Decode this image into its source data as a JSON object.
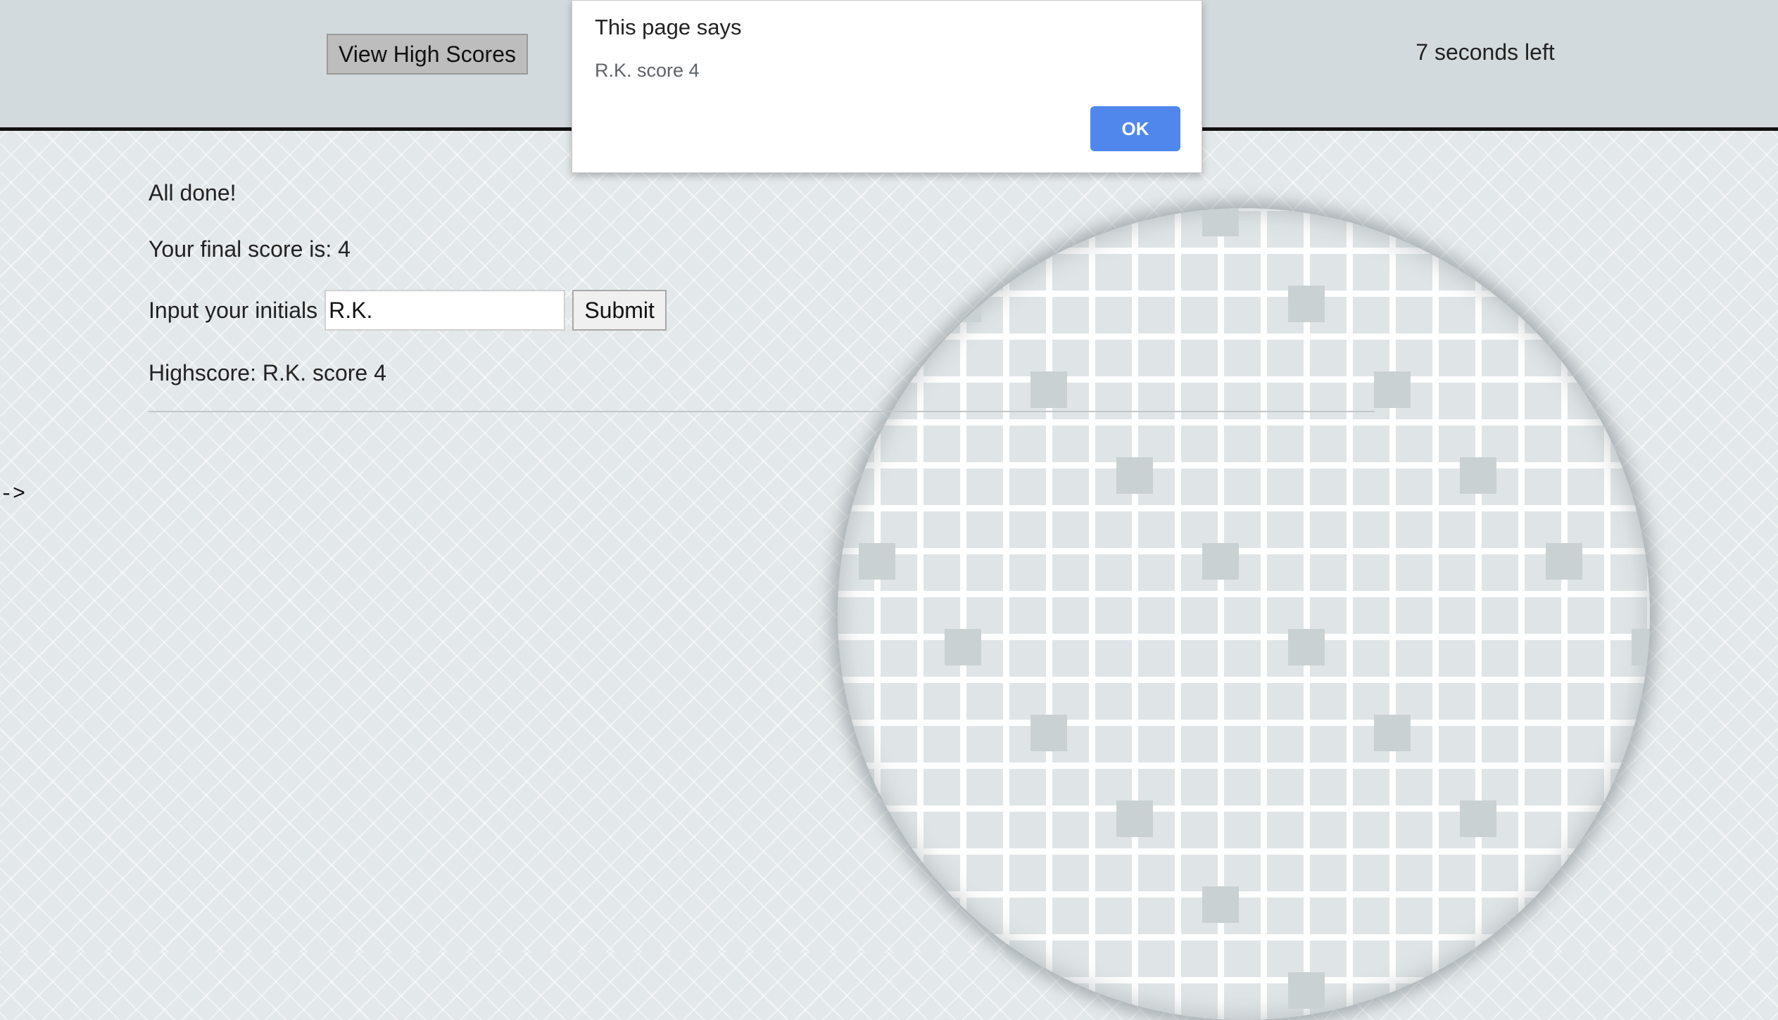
{
  "header": {
    "view_high_scores_label": "View High Scores",
    "timer_text": "7 seconds left"
  },
  "quiz": {
    "done_text": "All done!",
    "final_score_text": "Your final score is: 4",
    "initials_label": "Input your initials",
    "initials_value": "R.K.",
    "submit_label": "Submit",
    "highscore_text": "Highscore: R.K. score 4"
  },
  "arrow_text": "->",
  "dialog": {
    "title": "This page says",
    "message": "R.K. score 4",
    "ok_label": "OK"
  },
  "colors": {
    "ok_button": "#4f87ec",
    "header_background": "#d3dadd",
    "page_background": "#e3e8ea"
  }
}
